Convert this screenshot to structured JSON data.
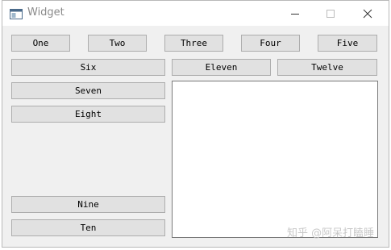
{
  "window": {
    "title": "Widget"
  },
  "titlebar": {
    "minimize_icon": "minimize-icon",
    "maximize_icon": "maximize-icon",
    "close_icon": "close-icon"
  },
  "buttons": {
    "one": "One",
    "two": "Two",
    "three": "Three",
    "four": "Four",
    "five": "Five",
    "six": "Six",
    "seven": "Seven",
    "eight": "Eight",
    "nine": "Nine",
    "ten": "Ten",
    "eleven": "Eleven",
    "twelve": "Twelve"
  },
  "text_edit": {
    "value": ""
  },
  "watermark": {
    "text": "知乎 @阿呆打瞌睡"
  },
  "colors": {
    "window_bg": "#f0f0f0",
    "button_bg": "#e1e1e1",
    "button_border": "#adadad",
    "title_text": "#8a8a8a"
  }
}
